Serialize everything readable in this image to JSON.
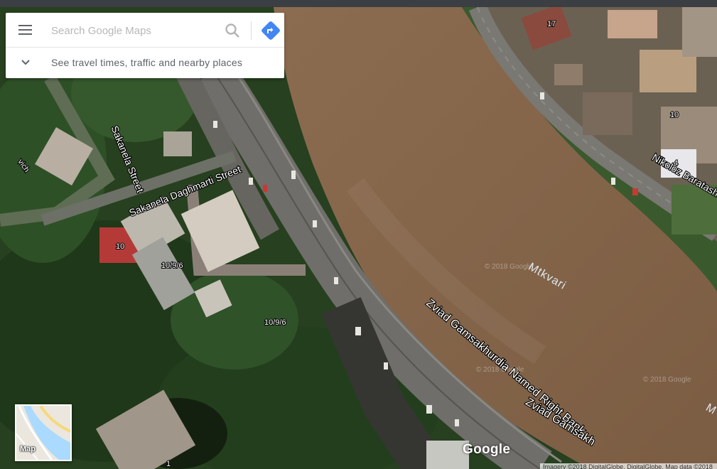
{
  "search": {
    "placeholder": "Search Google Maps",
    "expand_label": "See travel times, traffic and nearby places"
  },
  "map": {
    "view": "satellite",
    "toggle_label": "Map",
    "logo": "Google",
    "attribution": "Imagery ©2018 DigitalGlobe, DigitalGlobe, Map data ©2018",
    "watermarks": [
      "© 2018 Google",
      "© 2018 Google",
      "© 2018 Google"
    ],
    "water_label": "Mtkvari",
    "streets": [
      {
        "name": "Sakanela Street"
      },
      {
        "name": "Sakanela Daghmarti Street"
      },
      {
        "name": "Nikoloz Baratash"
      },
      {
        "name": "Zviad Gamsakhurdia Named Right Bank"
      },
      {
        "name": "Zviad Gamsakh"
      },
      {
        "name": "vich"
      }
    ],
    "house_numbers": [
      "17",
      "10",
      "4",
      "10",
      "10/9/6",
      "10/9/6",
      "1"
    ],
    "edge_label": "M"
  },
  "colors": {
    "river": "#8a6a4e",
    "accent": "#4285f4",
    "vegetation": "#2c4a26"
  },
  "icons": [
    "menu-icon",
    "search-icon",
    "directions-icon",
    "chevron-down-icon"
  ]
}
